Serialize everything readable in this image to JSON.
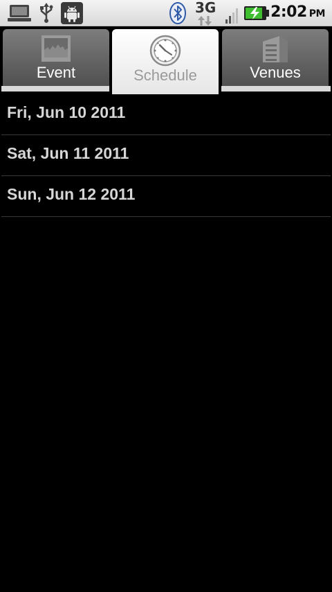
{
  "status_bar": {
    "icons": [
      "laptop-icon",
      "usb-icon",
      "android-debug-icon",
      "bluetooth-icon",
      "signal-icon",
      "battery-charging-icon"
    ],
    "network": "3G",
    "time": "2:02",
    "ampm": "PM"
  },
  "tabs": [
    {
      "label": "Event",
      "icon": "event-icon",
      "active": false
    },
    {
      "label": "Schedule",
      "icon": "clock-icon",
      "active": true
    },
    {
      "label": "Venues",
      "icon": "building-icon",
      "active": false
    }
  ],
  "schedule": {
    "days": [
      "Fri, Jun 10 2011",
      "Sat, Jun 11 2011",
      "Sun, Jun 12 2011"
    ]
  },
  "colors": {
    "background": "#000000",
    "list_text": "#d6d6d6",
    "active_tab": "#ffffff",
    "inactive_tab": "#606060",
    "battery_green": "#3fbf2f"
  }
}
